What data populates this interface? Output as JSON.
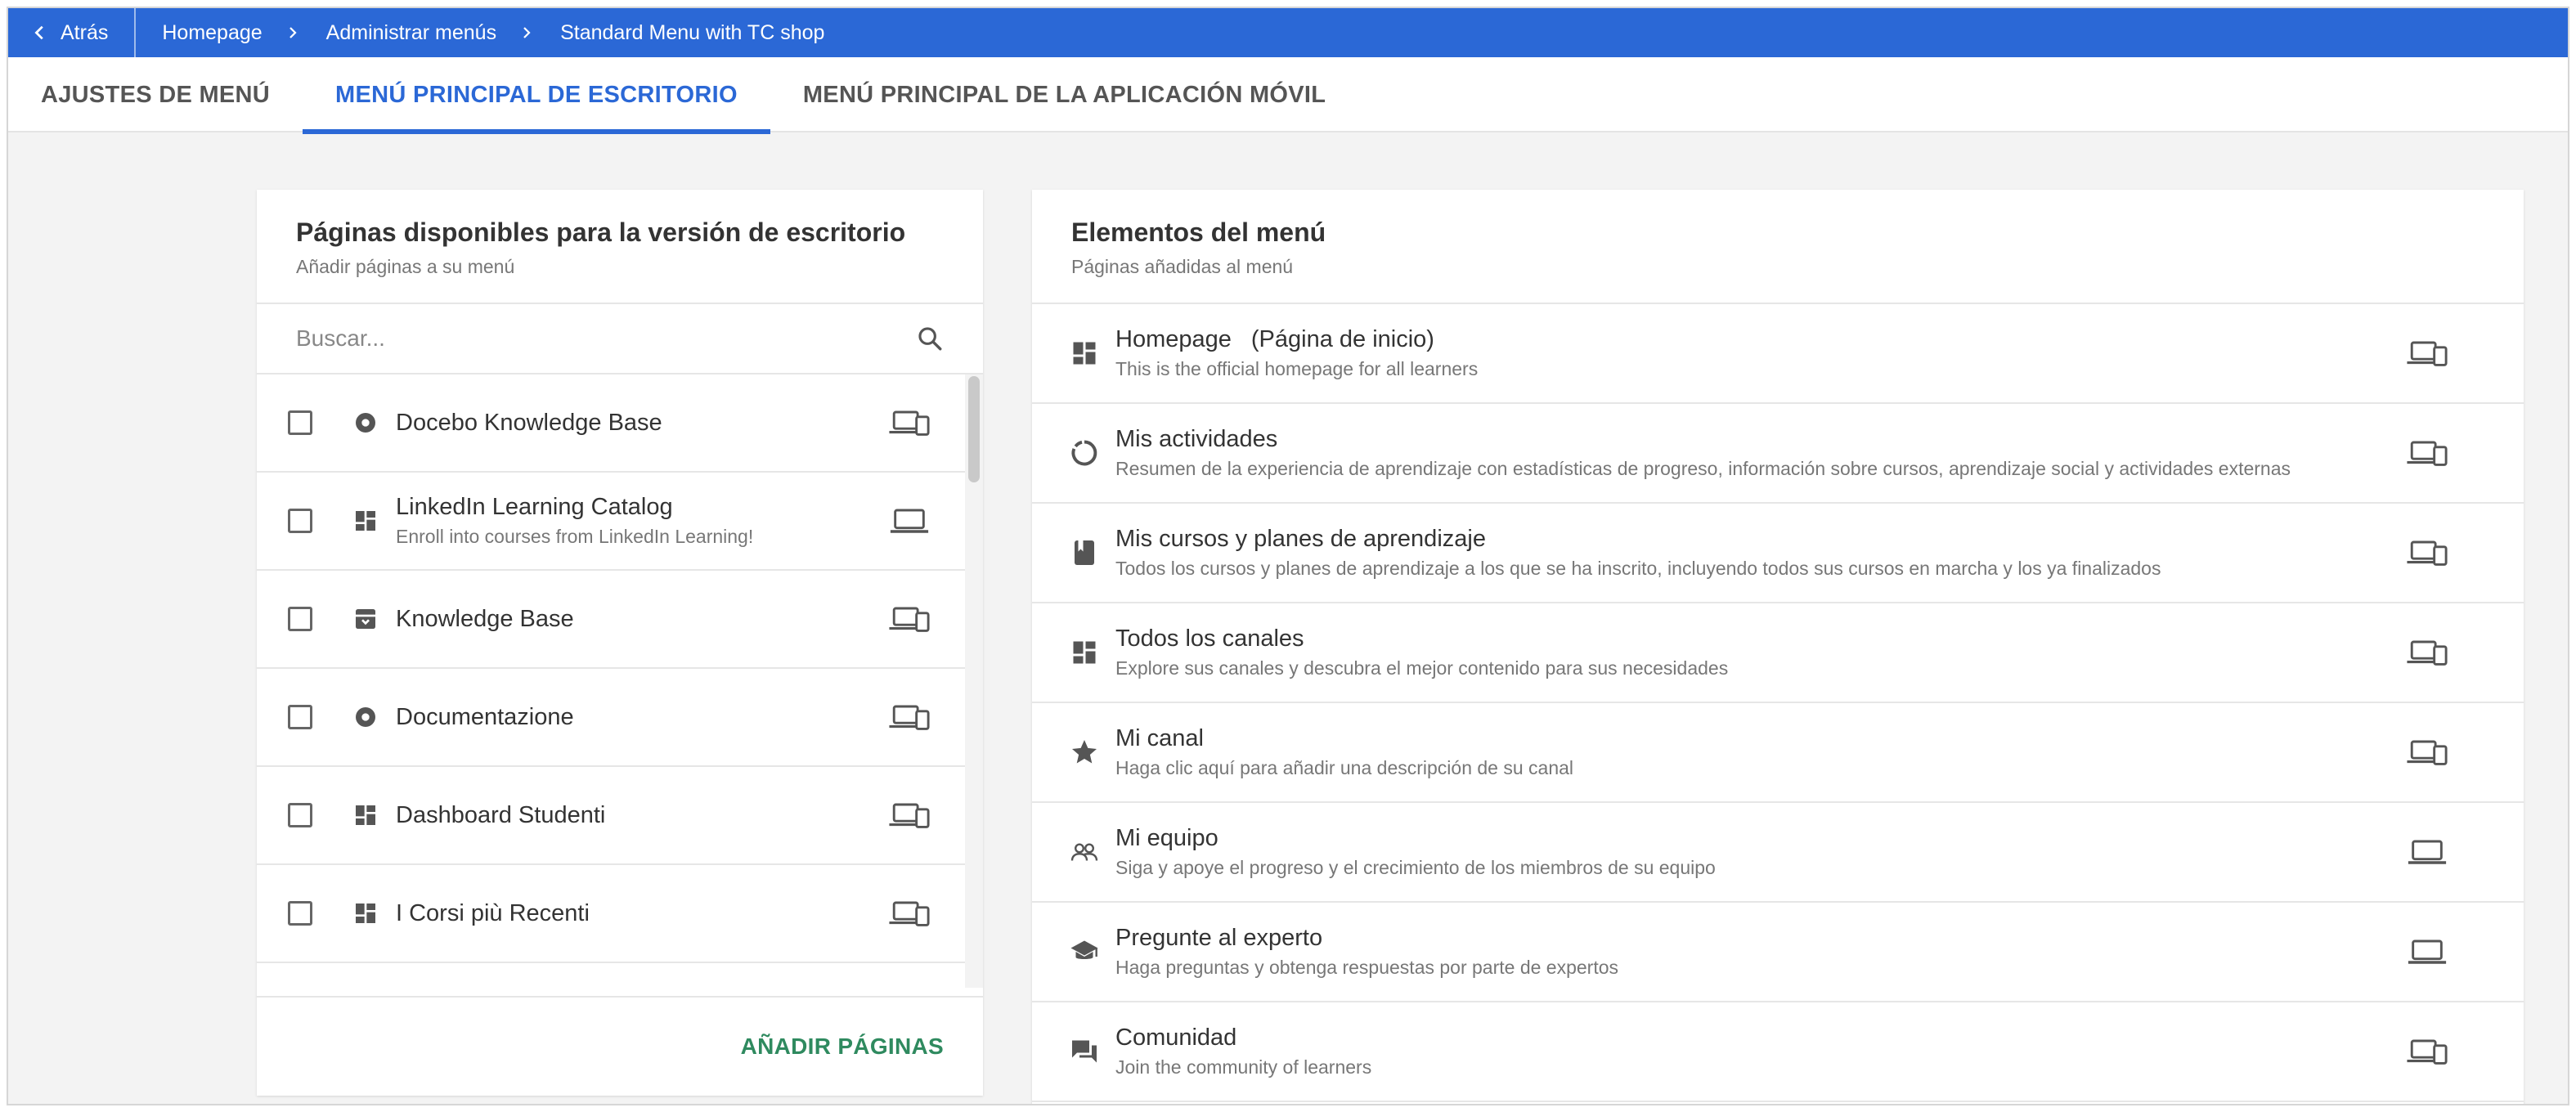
{
  "breadcrumb": {
    "back_label": "Atrás",
    "items": [
      "Homepage",
      "Administrar menús",
      "Standard Menu with TC shop"
    ]
  },
  "tabs": [
    {
      "label": "AJUSTES DE MENÚ",
      "active": false
    },
    {
      "label": "MENÚ PRINCIPAL DE ESCRITORIO",
      "active": true
    },
    {
      "label": "MENÚ PRINCIPAL DE LA APLICACIÓN MÓVIL",
      "active": false
    }
  ],
  "available": {
    "title": "Páginas disponibles para la versión de escritorio",
    "subtitle": "Añadir páginas a su menú",
    "search_placeholder": "Buscar...",
    "items": [
      {
        "title": "Docebo Knowledge Base",
        "desc": "",
        "icon": "circle-dot-icon",
        "device": "desktop-mobile-icon"
      },
      {
        "title": "LinkedIn Learning Catalog",
        "desc": "Enroll into courses from LinkedIn Learning!",
        "icon": "dashboard-icon",
        "device": "laptop-icon"
      },
      {
        "title": "Knowledge Base",
        "desc": "",
        "icon": "archive-icon",
        "device": "desktop-mobile-icon"
      },
      {
        "title": "Documentazione",
        "desc": "",
        "icon": "circle-dot-icon",
        "device": "desktop-mobile-icon"
      },
      {
        "title": "Dashboard Studenti",
        "desc": "",
        "icon": "dashboard-icon",
        "device": "desktop-mobile-icon"
      },
      {
        "title": "I Corsi più Recenti",
        "desc": "",
        "icon": "dashboard-icon",
        "device": "desktop-mobile-icon"
      }
    ],
    "add_button": "AÑADIR PÁGINAS"
  },
  "menu": {
    "title": "Elementos del menú",
    "subtitle": "Páginas añadidas al menú",
    "items": [
      {
        "title": "Homepage",
        "note": "(Página de inicio)",
        "desc": "This is the official homepage for all learners",
        "icon": "dashboard-icon",
        "device": "desktop-mobile-icon"
      },
      {
        "title": "Mis actividades",
        "note": "",
        "desc": "Resumen de la experiencia de aprendizaje con estadísticas de progreso, información sobre cursos, aprendizaje social y actividades externas",
        "icon": "progress-ring-icon",
        "device": "desktop-mobile-icon"
      },
      {
        "title": "Mis cursos y planes de aprendizaje",
        "note": "",
        "desc": "Todos los cursos y planes de aprendizaje a los que se ha inscrito, incluyendo todos sus cursos en marcha y los ya finalizados",
        "icon": "book-icon",
        "device": "desktop-mobile-icon"
      },
      {
        "title": "Todos los canales",
        "note": "",
        "desc": "Explore sus canales y descubra el mejor contenido para sus necesidades",
        "icon": "dashboard-icon",
        "device": "desktop-mobile-icon"
      },
      {
        "title": "Mi canal",
        "note": "",
        "desc": "Haga clic aquí para añadir una descripción de su canal",
        "icon": "star-icon",
        "device": "desktop-mobile-icon"
      },
      {
        "title": "Mi equipo",
        "note": "",
        "desc": "Siga y apoye el progreso y el crecimiento de los miembros de su equipo",
        "icon": "team-icon",
        "device": "laptop-icon"
      },
      {
        "title": "Pregunte al experto",
        "note": "",
        "desc": "Haga preguntas y obtenga respuestas por parte de expertos",
        "icon": "graduation-cap-icon",
        "device": "laptop-icon"
      },
      {
        "title": "Comunidad",
        "note": "",
        "desc": "Join the community of learners",
        "icon": "chat-icon",
        "device": "desktop-mobile-icon"
      }
    ]
  },
  "colors": {
    "accent": "#2b68d6",
    "add_button": "#2f8a5f",
    "icon": "#555555"
  }
}
